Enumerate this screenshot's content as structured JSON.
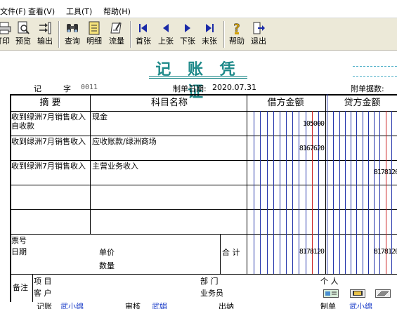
{
  "menu": {
    "items": [
      "文件(F)",
      "查看(V)",
      "工具(T)",
      "帮助(H)"
    ]
  },
  "toolbar": {
    "buttons": [
      {
        "label": "打印",
        "icon": "printer-icon"
      },
      {
        "label": "预览",
        "icon": "preview-icon"
      },
      {
        "label": "输出",
        "icon": "export-icon"
      },
      {
        "label": "查询",
        "icon": "binoculars-icon"
      },
      {
        "label": "明细",
        "icon": "detail-icon"
      },
      {
        "label": "流量",
        "icon": "flow-icon"
      },
      {
        "label": "首张",
        "icon": "first-icon"
      },
      {
        "label": "上张",
        "icon": "prev-icon"
      },
      {
        "label": "下张",
        "icon": "next-icon"
      },
      {
        "label": "末张",
        "icon": "last-icon"
      },
      {
        "label": "帮助",
        "icon": "help-icon"
      },
      {
        "label": "退出",
        "icon": "exit-icon"
      }
    ]
  },
  "voucher": {
    "title": "记 账 凭 证",
    "type_label": "记",
    "number_label": "字",
    "number": "0011",
    "date_label": "制单日期:",
    "date": "2020.07.31",
    "attachments_label": "附单据数:",
    "columns": {
      "summary": "摘 要",
      "account": "科目名称",
      "debit": "借方金额",
      "credit": "贷方金额"
    },
    "rows": [
      {
        "summary": "收到绿洲7月销售收入自收款",
        "account": "现金",
        "debit": "105000",
        "credit": ""
      },
      {
        "summary": "收到绿洲7月销售收入",
        "account": "应收账款/绿洲商场",
        "debit": "8167620",
        "credit": ""
      },
      {
        "summary": "收到绿洲7月销售收入",
        "account": "主营业务收入",
        "debit": "",
        "credit": "8178120"
      },
      {
        "summary": "",
        "account": "",
        "debit": "",
        "credit": ""
      },
      {
        "summary": "",
        "account": "",
        "debit": "",
        "credit": ""
      }
    ],
    "footer": {
      "ticket_no_label": "票号",
      "date_label": "日期",
      "unit_price_label": "单价",
      "quantity_label": "数量",
      "total_label": "合 计",
      "total_debit": "8178120",
      "total_credit": "8178120"
    },
    "notes": {
      "label": "备注",
      "project_label": "项 目",
      "customer_label": "客 户",
      "department_label": "部 门",
      "salesperson_label": "业务员",
      "individual_label": "个 人"
    },
    "signoff": {
      "bookkeeping_label": "记账",
      "bookkeeper": "武小绵",
      "review_label": "审核",
      "reviewer": "武娟",
      "cashier_label": "出纳",
      "preparer_label": "制单",
      "preparer": "武小绵"
    }
  },
  "colors": {
    "title": "#1f8a8a",
    "grid_blue": "#2233aa",
    "grid_red": "#cc2222",
    "signature": "#1a3cc8"
  }
}
